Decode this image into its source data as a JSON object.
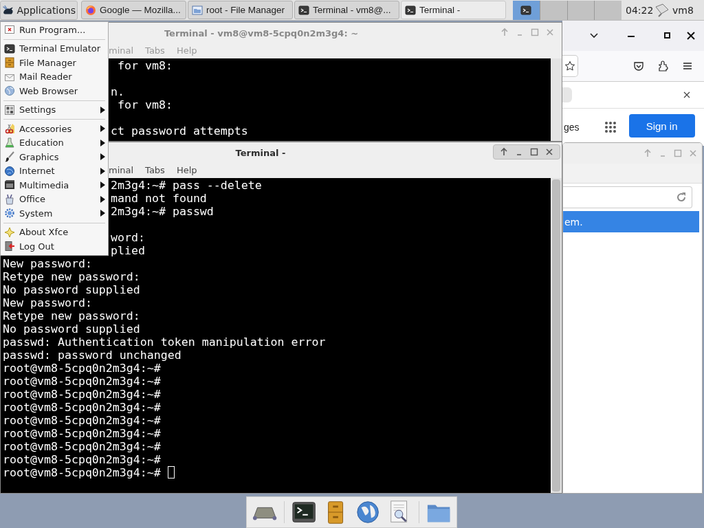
{
  "panel": {
    "applications": "Applications",
    "tasks": [
      {
        "label": "Google — Mozilla...",
        "selected": false
      },
      {
        "label": "root - File Manager",
        "selected": false
      },
      {
        "label": "Terminal - vm8@...",
        "selected": false
      },
      {
        "label": "Terminal -",
        "selected": true
      }
    ],
    "workspaces": [
      {
        "selected": true
      },
      {
        "selected": false
      },
      {
        "selected": false
      },
      {
        "selected": false
      }
    ],
    "clock": "04:22",
    "user": "vm8"
  },
  "app_menu": {
    "items": [
      {
        "kind": "item",
        "label": "Run Program...",
        "submenu": false
      },
      {
        "kind": "separator"
      },
      {
        "kind": "item",
        "label": "Terminal Emulator",
        "submenu": false
      },
      {
        "kind": "item",
        "label": "File Manager",
        "submenu": false
      },
      {
        "kind": "item",
        "label": "Mail Reader",
        "submenu": false
      },
      {
        "kind": "item",
        "label": "Web Browser",
        "submenu": false
      },
      {
        "kind": "separator"
      },
      {
        "kind": "item",
        "label": "Settings",
        "submenu": true
      },
      {
        "kind": "separator"
      },
      {
        "kind": "item",
        "label": "Accessories",
        "submenu": true
      },
      {
        "kind": "item",
        "label": "Education",
        "submenu": true
      },
      {
        "kind": "item",
        "label": "Graphics",
        "submenu": true
      },
      {
        "kind": "item",
        "label": "Internet",
        "submenu": true
      },
      {
        "kind": "item",
        "label": "Multimedia",
        "submenu": true
      },
      {
        "kind": "item",
        "label": "Office",
        "submenu": true
      },
      {
        "kind": "item",
        "label": "System",
        "submenu": true
      },
      {
        "kind": "separator"
      },
      {
        "kind": "item",
        "label": "About Xfce",
        "submenu": false
      },
      {
        "kind": "item",
        "label": "Log Out",
        "submenu": false
      }
    ]
  },
  "browser_window": {
    "nav_link": "ges",
    "sign_in_button": "Sign in"
  },
  "file_manager_window": {
    "rows": [
      {
        "text": "em.",
        "selected": true
      }
    ]
  },
  "back_terminal": {
    "title": "Terminal - vm8@vm8-5cpq0n2m3g4: ~",
    "active": false,
    "menu": [
      "minal",
      "Tabs",
      "Help"
    ],
    "lines": [
      {
        "kind": "text",
        "text": " for vm8:"
      },
      {
        "kind": "blank"
      },
      {
        "kind": "text",
        "text": "n."
      },
      {
        "kind": "text",
        "text": " for vm8:"
      },
      {
        "kind": "blank"
      },
      {
        "kind": "text",
        "text": "ct password attempts"
      }
    ]
  },
  "front_terminal": {
    "title": "Terminal -",
    "active": true,
    "cursor": true,
    "menu": [
      "minal",
      "Tabs",
      "Help"
    ],
    "lines": [
      {
        "kind": "text",
        "text": "2m3g4:~# pass --delete"
      },
      {
        "kind": "text",
        "text": "mand not found"
      },
      {
        "kind": "text",
        "text": "2m3g4:~# passwd"
      },
      {
        "kind": "blank"
      },
      {
        "kind": "text",
        "text": "word:"
      },
      {
        "kind": "text",
        "text": "plied"
      },
      {
        "kind": "text",
        "text": "New password:"
      },
      {
        "kind": "text",
        "text": "Retype new password:"
      },
      {
        "kind": "text",
        "text": "No password supplied"
      },
      {
        "kind": "text",
        "text": "New password:"
      },
      {
        "kind": "text",
        "text": "Retype new password:"
      },
      {
        "kind": "text",
        "text": "No password supplied"
      },
      {
        "kind": "text",
        "text": "passwd: Authentication token manipulation error"
      },
      {
        "kind": "text",
        "text": "passwd: password unchanged"
      },
      {
        "kind": "text",
        "text": "root@vm8-5cpq0n2m3g4:~#"
      },
      {
        "kind": "text",
        "text": "root@vm8-5cpq0n2m3g4:~#"
      },
      {
        "kind": "text",
        "text": "root@vm8-5cpq0n2m3g4:~#"
      },
      {
        "kind": "text",
        "text": "root@vm8-5cpq0n2m3g4:~#"
      },
      {
        "kind": "text",
        "text": "root@vm8-5cpq0n2m3g4:~#"
      },
      {
        "kind": "text",
        "text": "root@vm8-5cpq0n2m3g4:~#"
      },
      {
        "kind": "text",
        "text": "root@vm8-5cpq0n2m3g4:~#"
      },
      {
        "kind": "text",
        "text": "root@vm8-5cpq0n2m3g4:~#"
      },
      {
        "kind": "text",
        "text": "root@vm8-5cpq0n2m3g4:~#"
      }
    ]
  }
}
